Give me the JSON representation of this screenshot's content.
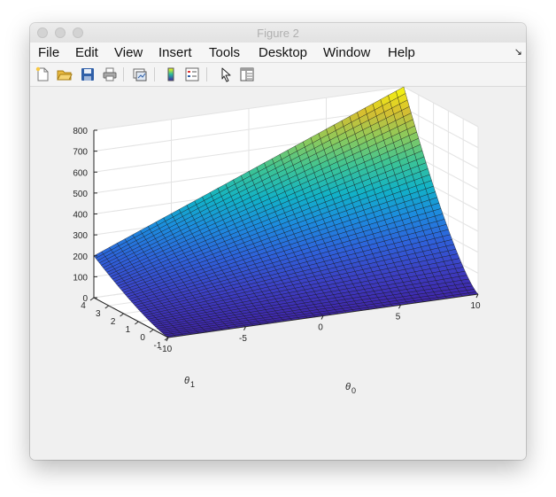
{
  "window": {
    "title": "Figure 2"
  },
  "menubar": {
    "items": [
      "File",
      "Edit",
      "View",
      "Insert",
      "Tools",
      "Desktop",
      "Window",
      "Help"
    ]
  },
  "toolbar": {
    "icons": [
      "new-figure-icon",
      "open-file-icon",
      "save-icon",
      "print-icon",
      "link-plot-icon",
      "colorbar-icon",
      "legend-icon",
      "pointer-icon",
      "property-inspector-icon"
    ]
  },
  "chart_data": {
    "type": "surface",
    "title": "",
    "xlabel": "θ0",
    "ylabel": "θ1",
    "zlabel": "",
    "xlim": [
      -10,
      10
    ],
    "ylim": [
      -1,
      4
    ],
    "zlim": [
      0,
      800
    ],
    "x_ticks": [
      "-10",
      "-5",
      "0",
      "5",
      "10"
    ],
    "y_ticks": [
      "-1",
      "0",
      "1",
      "2",
      "3",
      "4"
    ],
    "z_ticks": [
      "0",
      "100",
      "200",
      "300",
      "400",
      "500",
      "600",
      "700",
      "800"
    ],
    "grid": true,
    "colormap": "parula",
    "corner_values": [
      {
        "x": -10,
        "y": -1,
        "z": 0
      },
      {
        "x": 10,
        "y": -1,
        "z": 0
      },
      {
        "x": -10,
        "y": 4,
        "z": 200
      },
      {
        "x": 10,
        "y": 4,
        "z": 800
      }
    ]
  }
}
